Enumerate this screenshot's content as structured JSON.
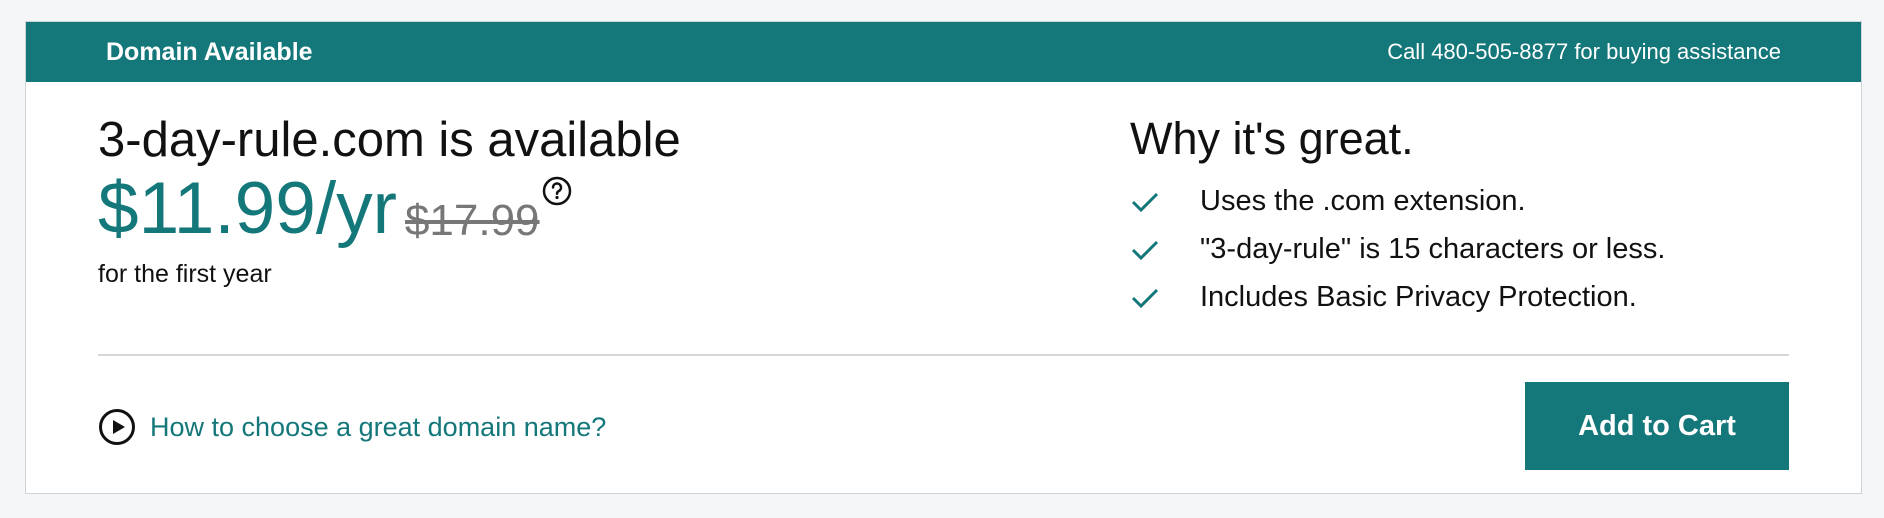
{
  "header": {
    "title": "Domain Available",
    "phone_text": "Call 480-505-8877 for buying assistance"
  },
  "domain": {
    "title": "3-day-rule.com is available",
    "price": "$11.99/yr",
    "old_price": "$17.99",
    "price_note": "for the first year",
    "help_icon": "question-circle-icon"
  },
  "why": {
    "title": "Why it's great.",
    "features": [
      {
        "icon": "check-icon",
        "text": "Uses the .com extension."
      },
      {
        "icon": "check-icon",
        "text": "\"3-day-rule\" is 15 characters or less."
      },
      {
        "icon": "check-icon",
        "text": "Includes Basic Privacy Protection."
      }
    ]
  },
  "footer": {
    "how_link": "How to choose a great domain name?",
    "how_icon": "play-circle-icon",
    "add_to_cart": "Add to Cart"
  },
  "colors": {
    "brand": "#14777a",
    "background": "#f4f6f8",
    "old_price": "#777777"
  }
}
